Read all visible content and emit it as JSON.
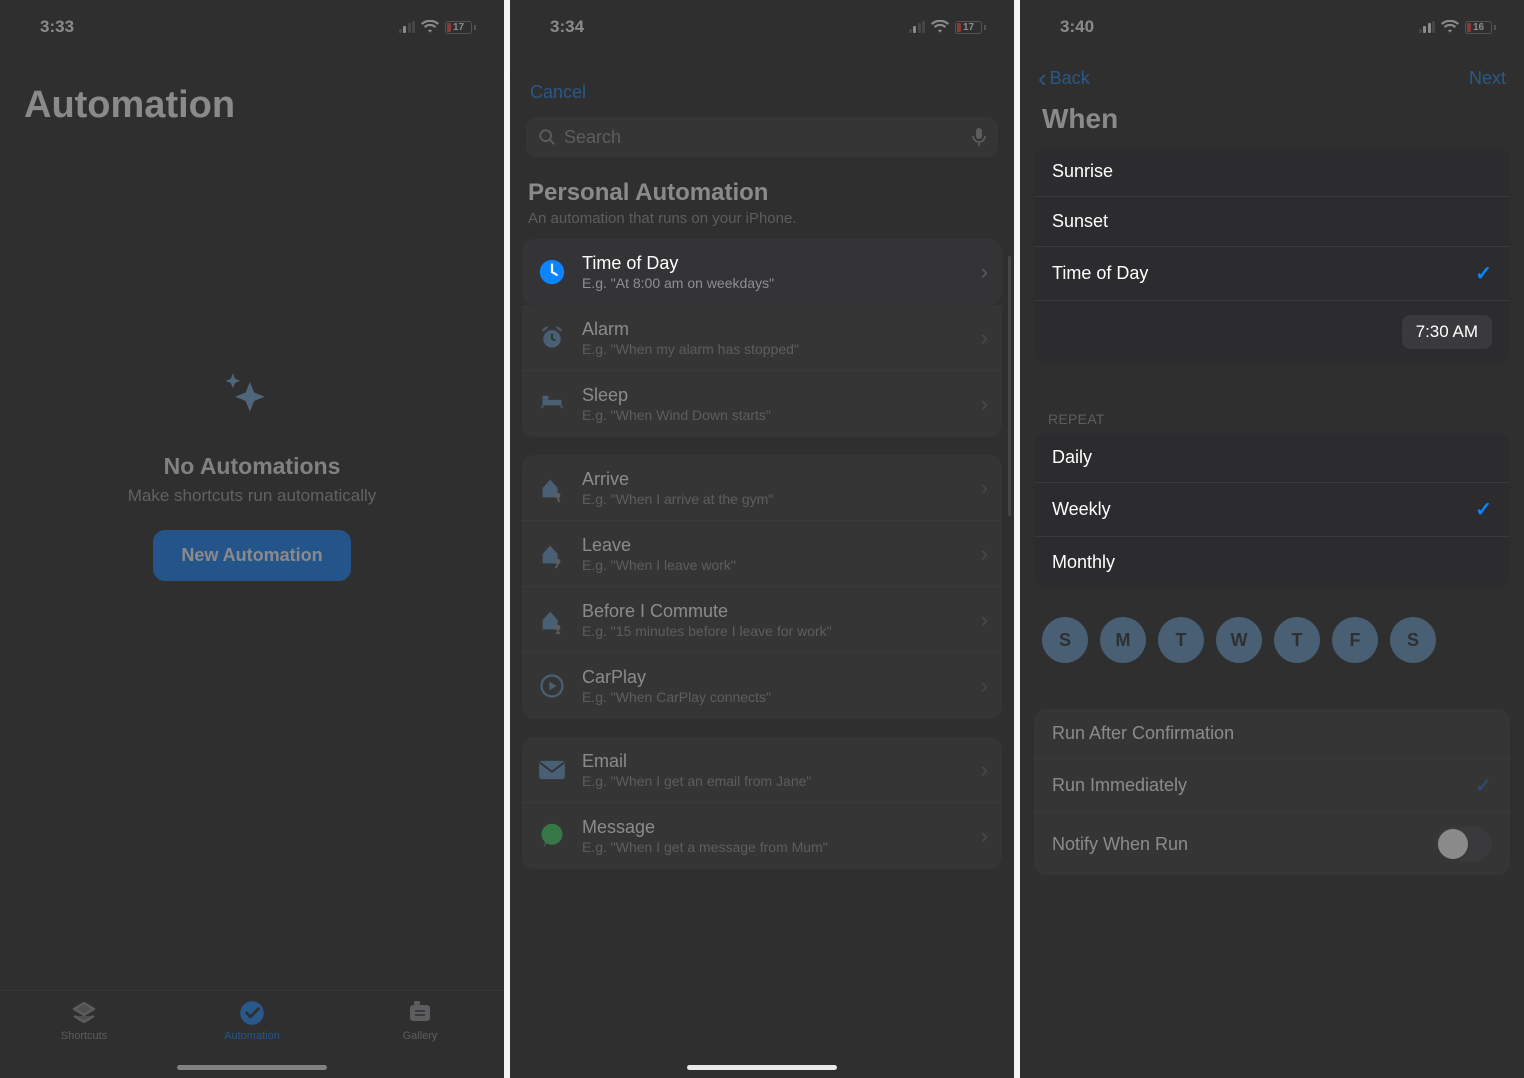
{
  "screen1": {
    "status": {
      "time": "3:33",
      "battery": "17"
    },
    "title": "Automation",
    "empty": {
      "heading": "No Automations",
      "sub": "Make shortcuts run automatically",
      "button": "New Automation"
    },
    "tabs": {
      "shortcuts": "Shortcuts",
      "automation": "Automation",
      "gallery": "Gallery"
    }
  },
  "screen2": {
    "status": {
      "time": "3:34",
      "battery": "17"
    },
    "cancel": "Cancel",
    "search_placeholder": "Search",
    "section_title": "Personal Automation",
    "section_sub": "An automation that runs on your iPhone.",
    "rows": {
      "time_of_day": {
        "title": "Time of Day",
        "sub": "E.g. \"At 8:00 am on weekdays\""
      },
      "alarm": {
        "title": "Alarm",
        "sub": "E.g. \"When my alarm has stopped\""
      },
      "sleep": {
        "title": "Sleep",
        "sub": "E.g. \"When Wind Down starts\""
      },
      "arrive": {
        "title": "Arrive",
        "sub": "E.g. \"When I arrive at the gym\""
      },
      "leave": {
        "title": "Leave",
        "sub": "E.g. \"When I leave work\""
      },
      "before_commute": {
        "title": "Before I Commute",
        "sub": "E.g. \"15 minutes before I leave for work\""
      },
      "carplay": {
        "title": "CarPlay",
        "sub": "E.g. \"When CarPlay connects\""
      },
      "email": {
        "title": "Email",
        "sub": "E.g. \"When I get an email from Jane\""
      },
      "message": {
        "title": "Message",
        "sub": "E.g. \"When I get a message from Mum\""
      }
    }
  },
  "screen3": {
    "status": {
      "time": "3:40",
      "battery": "16"
    },
    "back": "Back",
    "next": "Next",
    "title": "When",
    "when": {
      "sunrise": "Sunrise",
      "sunset": "Sunset",
      "time_of_day": "Time of Day",
      "time_value": "7:30 AM"
    },
    "repeat_label": "REPEAT",
    "repeat": {
      "daily": "Daily",
      "weekly": "Weekly",
      "monthly": "Monthly"
    },
    "days": [
      "S",
      "M",
      "T",
      "W",
      "T",
      "F",
      "S"
    ],
    "run": {
      "after_confirm": "Run After Confirmation",
      "immediately": "Run Immediately",
      "notify": "Notify When Run"
    }
  }
}
